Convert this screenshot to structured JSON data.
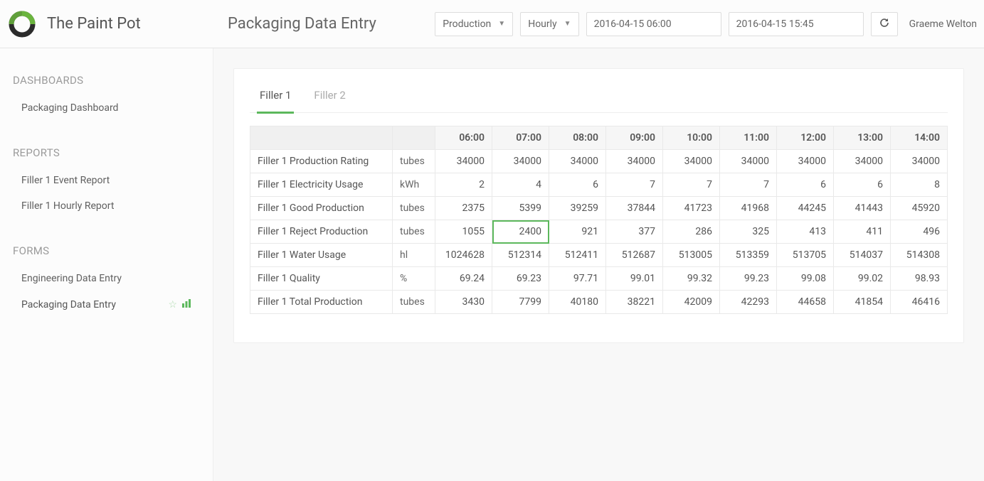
{
  "brand": {
    "name": "The Paint Pot"
  },
  "header": {
    "page_title": "Packaging Data Entry",
    "view_select": "Production",
    "interval_select": "Hourly",
    "from": "2016-04-15 06:00",
    "to": "2016-04-15 15:45",
    "user": "Graeme Welton"
  },
  "sidebar": {
    "sections": [
      {
        "title": "DASHBOARDS",
        "items": [
          {
            "label": "Packaging Dashboard"
          }
        ]
      },
      {
        "title": "REPORTS",
        "items": [
          {
            "label": "Filler 1 Event Report"
          },
          {
            "label": "Filler 1 Hourly Report"
          }
        ]
      },
      {
        "title": "FORMS",
        "items": [
          {
            "label": "Engineering Data Entry"
          },
          {
            "label": "Packaging Data Entry",
            "active": true,
            "decor": true
          }
        ]
      }
    ]
  },
  "content": {
    "tabs": [
      {
        "label": "Filler 1",
        "active": true
      },
      {
        "label": "Filler 2"
      }
    ],
    "columns": [
      "06:00",
      "07:00",
      "08:00",
      "09:00",
      "10:00",
      "11:00",
      "12:00",
      "13:00",
      "14:00"
    ],
    "editing": {
      "row": 3,
      "col": 1
    },
    "rows": [
      {
        "label": "Filler 1 Production Rating",
        "unit": "tubes",
        "values": [
          "34000",
          "34000",
          "34000",
          "34000",
          "34000",
          "34000",
          "34000",
          "34000",
          "34000"
        ]
      },
      {
        "label": "Filler 1 Electricity Usage",
        "unit": "kWh",
        "values": [
          "2",
          "4",
          "6",
          "7",
          "7",
          "7",
          "6",
          "6",
          "8"
        ]
      },
      {
        "label": "Filler 1 Good Production",
        "unit": "tubes",
        "values": [
          "2375",
          "5399",
          "39259",
          "37844",
          "41723",
          "41968",
          "44245",
          "41443",
          "45920"
        ]
      },
      {
        "label": "Filler 1 Reject Production",
        "unit": "tubes",
        "values": [
          "1055",
          "2400",
          "921",
          "377",
          "286",
          "325",
          "413",
          "411",
          "496"
        ]
      },
      {
        "label": "Filler 1 Water Usage",
        "unit": "hl",
        "values": [
          "1024628",
          "512314",
          "512411",
          "512687",
          "513005",
          "513359",
          "513705",
          "514037",
          "514308"
        ]
      },
      {
        "label": "Filler 1 Quality",
        "unit": "%",
        "values": [
          "69.24",
          "69.23",
          "97.71",
          "99.01",
          "99.32",
          "99.23",
          "99.08",
          "99.02",
          "98.93"
        ]
      },
      {
        "label": "Filler 1 Total Production",
        "unit": "tubes",
        "values": [
          "3430",
          "7799",
          "40180",
          "38221",
          "42009",
          "42293",
          "44658",
          "41854",
          "46416"
        ]
      }
    ]
  }
}
